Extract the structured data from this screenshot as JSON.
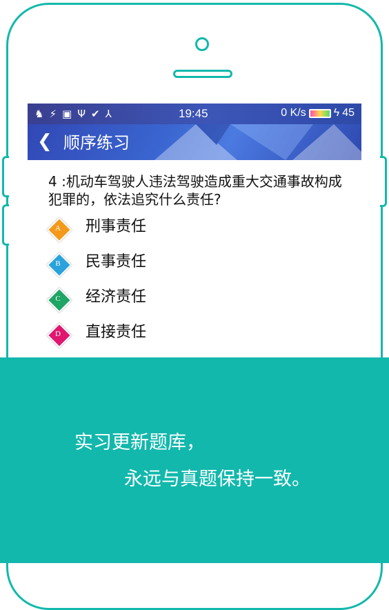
{
  "status_bar": {
    "icons": [
      "pony-icon",
      "weather-icon",
      "image-icon",
      "usb-icon",
      "check-circle-icon",
      "radiation-icon"
    ],
    "time": "19:45",
    "speed": "0 K/s",
    "battery_level": "45"
  },
  "app_bar": {
    "title": "顺序练习",
    "back_icon": "chevron-left-icon"
  },
  "question": {
    "text": "4 :机动车驾驶人违法驾驶造成重大交通事故构成犯罪的，依法追究什么责任?"
  },
  "options": [
    {
      "letter": "A",
      "text": "刑事责任",
      "color": "#f39a1b"
    },
    {
      "letter": "B",
      "text": "民事责任",
      "color": "#2aa3dc"
    },
    {
      "letter": "C",
      "text": "经济责任",
      "color": "#1fa565"
    },
    {
      "letter": "D",
      "text": "直接责任",
      "color": "#e0176e"
    }
  ],
  "banner": {
    "line1": "实习更新题库，",
    "line2": "永远与真题保持一致。",
    "background": "#12b8ac"
  },
  "colors": {
    "phone_outline": "#12b8ac",
    "app_bar": "#3a5ec8"
  }
}
